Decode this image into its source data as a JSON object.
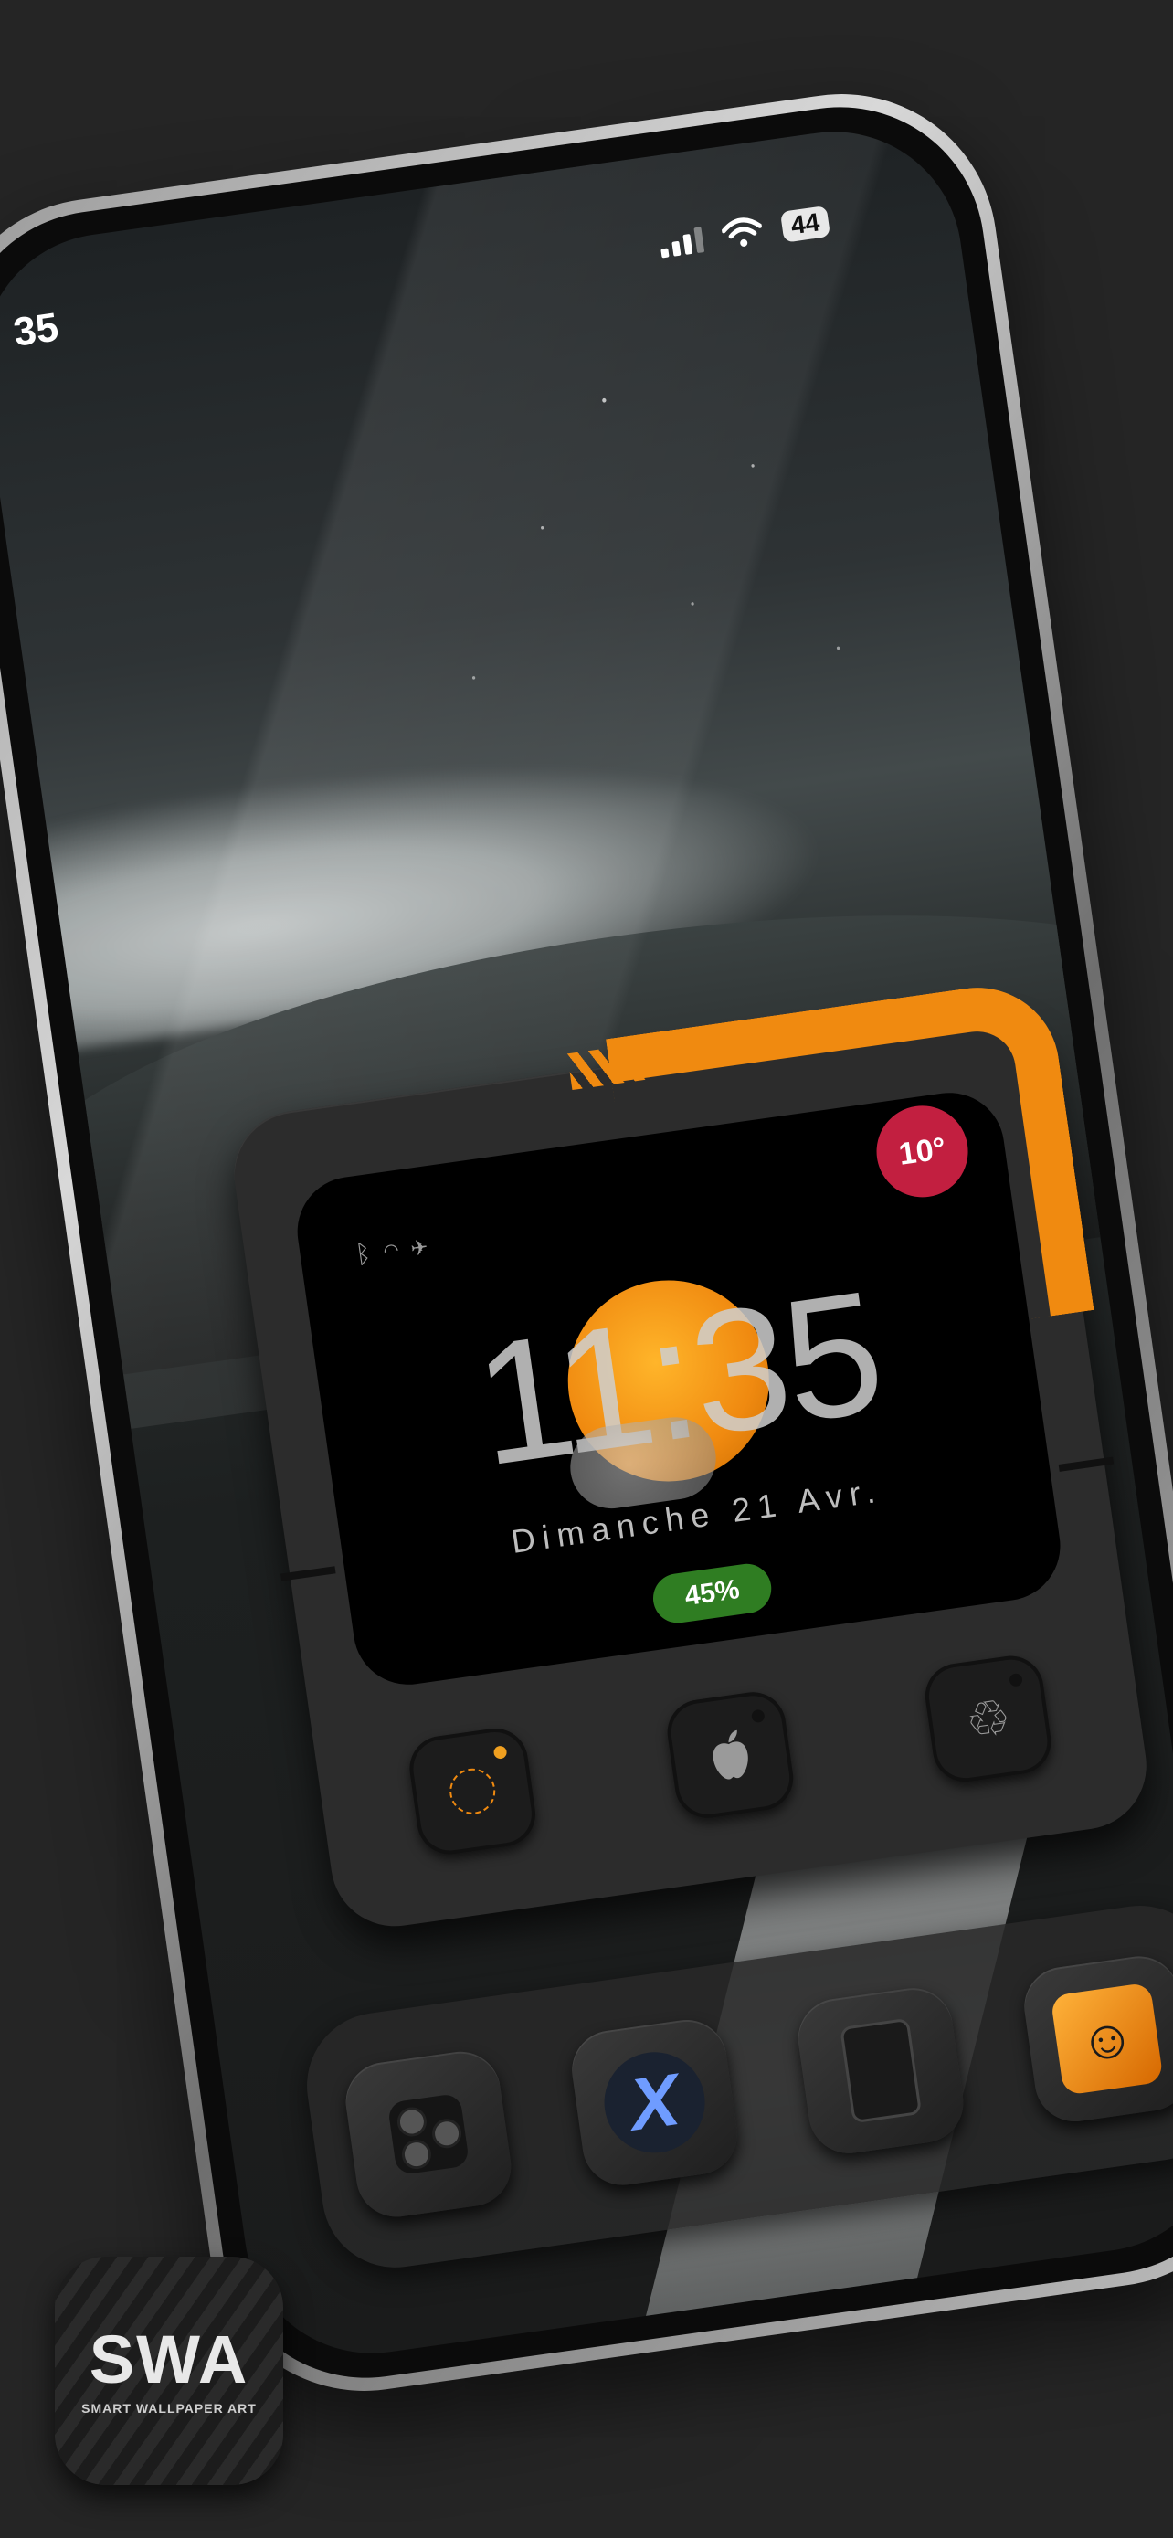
{
  "status_bar": {
    "time_fragment": "35",
    "battery_level": "44",
    "icons": [
      "cellular-signal-icon",
      "wifi-icon"
    ]
  },
  "widget": {
    "temperature": "10°",
    "status_icons": [
      "bluetooth-icon",
      "wifi-icon",
      "airplane-mode-icon"
    ],
    "clock_time": "11:35",
    "date": "Dimanche 21 Avr.",
    "battery_percent": "45%",
    "battery_level_fraction": 0.45,
    "buttons": [
      {
        "name": "focus-button",
        "icon": "focus-ring-icon"
      },
      {
        "name": "apple-button",
        "icon": "apple-logo-icon"
      },
      {
        "name": "recycle-button",
        "icon": "recycle-icon"
      }
    ]
  },
  "dock": {
    "apps": [
      {
        "name": "camera-app",
        "icon": "camera-icon"
      },
      {
        "name": "x-app",
        "icon": "x-logo-icon",
        "letter": "X"
      },
      {
        "name": "wallet-app",
        "icon": "wallet-icon"
      },
      {
        "name": "finder-app",
        "icon": "finder-icon"
      }
    ]
  },
  "app_badge": {
    "title": "SWA",
    "subtitle": "SMART WALLPAPER ART"
  },
  "colors": {
    "accent_orange": "#f08a10",
    "temp_red": "#c21f40",
    "battery_green": "#2f7d22",
    "background": "#252525"
  }
}
